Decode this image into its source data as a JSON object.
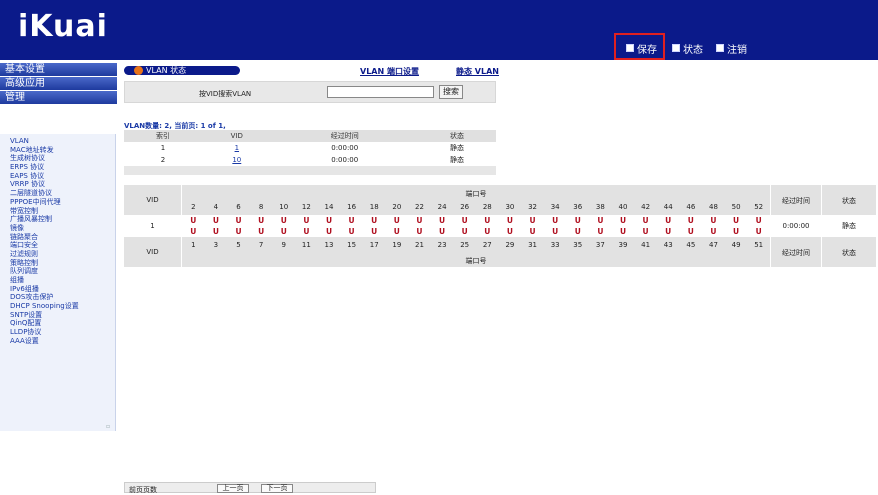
{
  "header": {
    "logo": "iKuai",
    "nav": [
      {
        "label": "保存",
        "icon": "save-icon"
      },
      {
        "label": "状态",
        "icon": "status-icon"
      },
      {
        "label": "注销",
        "icon": "logout-icon"
      }
    ]
  },
  "left_categories": [
    "基本设置",
    "高级应用",
    "管理"
  ],
  "sidebar": {
    "items": [
      "VLAN",
      "MAC地址转发",
      "生成树协议",
      "ERPS 协议",
      "EAPS 协议",
      "VRRP 协议",
      "二层隧道协议",
      "PPPOE中间代理",
      "带宽控制",
      "广播风暴控制",
      "镜像",
      "链路聚合",
      "端口安全",
      "过滤规则",
      "策略控制",
      "队列调度",
      "组播",
      "IPv6组播",
      "DOS攻击保护",
      "DHCP Snooping设置",
      "SNTP设置",
      "QinQ配置",
      "LLDP协议",
      "AAA设置"
    ]
  },
  "vlan_status": {
    "title": "VLAN 状态",
    "link_port": "VLAN 端口设置",
    "link_static": "静态 VLAN",
    "search_label": "按VID搜索VLAN",
    "search_value": "",
    "search_button": "搜索",
    "count_text": "VLAN数量: 2,   当前页: 1 of 1,"
  },
  "vlan_table": {
    "headers": [
      "索引",
      "VID",
      "经过时间",
      "状态"
    ],
    "rows": [
      [
        "1",
        "1",
        "0:00:00",
        "静态"
      ],
      [
        "2",
        "10",
        "0:00:00",
        "静态"
      ]
    ]
  },
  "port_table": {
    "vid_header": "VID",
    "port_header": "端口号",
    "time_header": "经过时间",
    "state_header": "状态",
    "even_ports": [
      "2",
      "4",
      "6",
      "8",
      "10",
      "12",
      "14",
      "16",
      "18",
      "20",
      "22",
      "24",
      "26",
      "28",
      "30",
      "32",
      "34",
      "36",
      "38",
      "40",
      "42",
      "44",
      "46",
      "48",
      "50",
      "52"
    ],
    "odd_ports": [
      "1",
      "3",
      "5",
      "7",
      "9",
      "11",
      "13",
      "15",
      "17",
      "19",
      "21",
      "23",
      "25",
      "27",
      "29",
      "31",
      "33",
      "35",
      "37",
      "39",
      "41",
      "43",
      "45",
      "47",
      "49",
      "51"
    ],
    "row": {
      "vid": "1",
      "mark": "U",
      "time": "0:00:00",
      "state": "静态"
    }
  },
  "pager": {
    "label": "前页页数",
    "prev": "上一页",
    "next": "下一页"
  }
}
